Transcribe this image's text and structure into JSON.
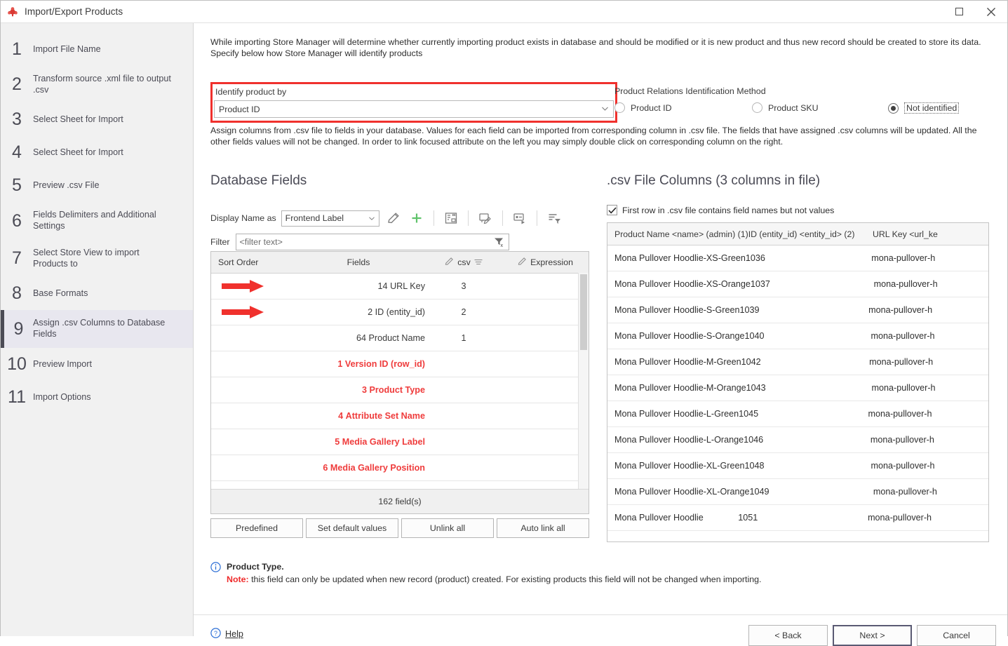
{
  "window": {
    "title": "Import/Export Products",
    "app_icon": "store-manager-icon",
    "maximize_label": "Maximize",
    "close_label": "Close"
  },
  "sidebar": {
    "steps": [
      {
        "num": "1",
        "label": "Import File Name",
        "active": false
      },
      {
        "num": "2",
        "label": "Transform source .xml file to output .csv",
        "active": false
      },
      {
        "num": "3",
        "label": "Select Sheet for Import",
        "active": false
      },
      {
        "num": "4",
        "label": "Select Sheet for Import",
        "active": false
      },
      {
        "num": "5",
        "label": "Preview .csv File",
        "active": false
      },
      {
        "num": "6",
        "label": "Fields Delimiters and Additional Settings",
        "active": false
      },
      {
        "num": "7",
        "label": "Select Store View to import Products to",
        "active": false
      },
      {
        "num": "8",
        "label": "Base Formats",
        "active": false
      },
      {
        "num": "9",
        "label": "Assign .csv Columns to Database Fields",
        "active": true
      },
      {
        "num": "10",
        "label": "Preview Import",
        "active": false
      },
      {
        "num": "11",
        "label": "Import Options",
        "active": false
      }
    ]
  },
  "main": {
    "intro_text": "While importing Store Manager will determine whether currently importing product exists in database and should be modified or it is new product and thus new record should be created to store its data. Specify below how Store Manager will identify products",
    "identify": {
      "label": "Identify product by",
      "value": "Product ID",
      "highlight_color": "#f0312d"
    },
    "relations": {
      "title": "Product Relations Identification Method",
      "options": [
        {
          "label": "Product ID",
          "selected": false,
          "focused": false
        },
        {
          "label": "Product SKU",
          "selected": false,
          "focused": false
        },
        {
          "label": "Not identified",
          "selected": true,
          "focused": true
        }
      ]
    },
    "assign_text": "Assign columns from .csv file to fields in your database. Values for each field can be imported from corresponding column in .csv file. The fields that have assigned .csv columns will be updated. All the other fields values will not be changed. In order to link focused attribute on the left you may simply double click on corresponding column on the right."
  },
  "database_fields": {
    "title": "Database Fields",
    "display_name_label": "Display Name as",
    "display_name_value": "Frontend Label",
    "toolbar_icons": [
      "edit-pencil-icon",
      "add-plus-icon",
      "link-field-icon",
      "edit-mapping-icon",
      "apply-mapping-icon",
      "sort-filter-icon"
    ],
    "filter_label": "Filter",
    "filter_placeholder": "<filter text>",
    "clear_filter_icon": "clear-filter-icon",
    "columns": [
      {
        "label": "Sort Order"
      },
      {
        "label": "Fields"
      },
      {
        "label": "csv",
        "icon": "pencil-icon",
        "sort_icon": "sort-icon"
      },
      {
        "label": "Expression",
        "icon": "pencil-icon"
      }
    ],
    "rows": [
      {
        "sort": "14",
        "field": "URL Key",
        "csv": "3",
        "expression": "",
        "unlinked": false,
        "marker": true
      },
      {
        "sort": "2",
        "field": "ID (entity_id)",
        "csv": "2",
        "expression": "",
        "unlinked": false,
        "marker": true
      },
      {
        "sort": "64",
        "field": "Product Name",
        "csv": "1",
        "expression": "",
        "unlinked": false,
        "marker": false
      },
      {
        "sort": "1",
        "field": "Version ID (row_id)",
        "csv": "",
        "expression": "",
        "unlinked": true,
        "marker": false
      },
      {
        "sort": "3",
        "field": "Product Type",
        "csv": "",
        "expression": "",
        "unlinked": true,
        "marker": false
      },
      {
        "sort": "4",
        "field": "Attribute Set Name",
        "csv": "",
        "expression": "",
        "unlinked": true,
        "marker": false
      },
      {
        "sort": "5",
        "field": "Media Gallery Label",
        "csv": "",
        "expression": "",
        "unlinked": true,
        "marker": false
      },
      {
        "sort": "6",
        "field": "Media Gallery Position",
        "csv": "",
        "expression": "",
        "unlinked": true,
        "marker": false
      }
    ],
    "footer_count": "162 field(s)",
    "buttons": [
      "Predefined",
      "Set default values",
      "Unlink all",
      "Auto link all"
    ]
  },
  "csv_columns": {
    "title": ".csv File Columns (3 columns in file)",
    "first_row_checkbox": {
      "label": "First row in .csv file contains field names but not values",
      "checked": true
    },
    "columns": [
      "Product Name <name> (admin) (1)",
      "ID (entity_id) <entity_id> (2)",
      "URL Key <url_ke"
    ],
    "rows": [
      [
        "Mona Pullover Hoodlie-XS-Green",
        "1036",
        "mona-pullover-h"
      ],
      [
        "Mona Pullover Hoodlie-XS-Orange",
        "1037",
        "mona-pullover-h"
      ],
      [
        "Mona Pullover Hoodlie-S-Green",
        "1039",
        "mona-pullover-h"
      ],
      [
        "Mona Pullover Hoodlie-S-Orange",
        "1040",
        "mona-pullover-h"
      ],
      [
        "Mona Pullover Hoodlie-M-Green",
        "1042",
        "mona-pullover-h"
      ],
      [
        "Mona Pullover Hoodlie-M-Orange",
        "1043",
        "mona-pullover-h"
      ],
      [
        "Mona Pullover Hoodlie-L-Green",
        "1045",
        "mona-pullover-h"
      ],
      [
        "Mona Pullover Hoodlie-L-Orange",
        "1046",
        "mona-pullover-h"
      ],
      [
        "Mona Pullover Hoodlie-XL-Green",
        "1048",
        "mona-pullover-h"
      ],
      [
        "Mona Pullover Hoodlie-XL-Orange",
        "1049",
        "mona-pullover-h"
      ],
      [
        "Mona Pullover Hoodlie",
        "1051",
        "mona-pullover-h"
      ]
    ]
  },
  "note": {
    "icon": "info-icon",
    "title": "Product Type.",
    "prefix": "Note:",
    "text": " this field can only be updated when new record (product) created. For existing products this field will not be changed when importing."
  },
  "footer": {
    "help_label": "Help",
    "help_icon": "question-icon",
    "buttons": [
      {
        "label": "< Back",
        "default": false
      },
      {
        "label": "Next >",
        "default": true
      },
      {
        "label": "Cancel",
        "default": false
      }
    ]
  }
}
